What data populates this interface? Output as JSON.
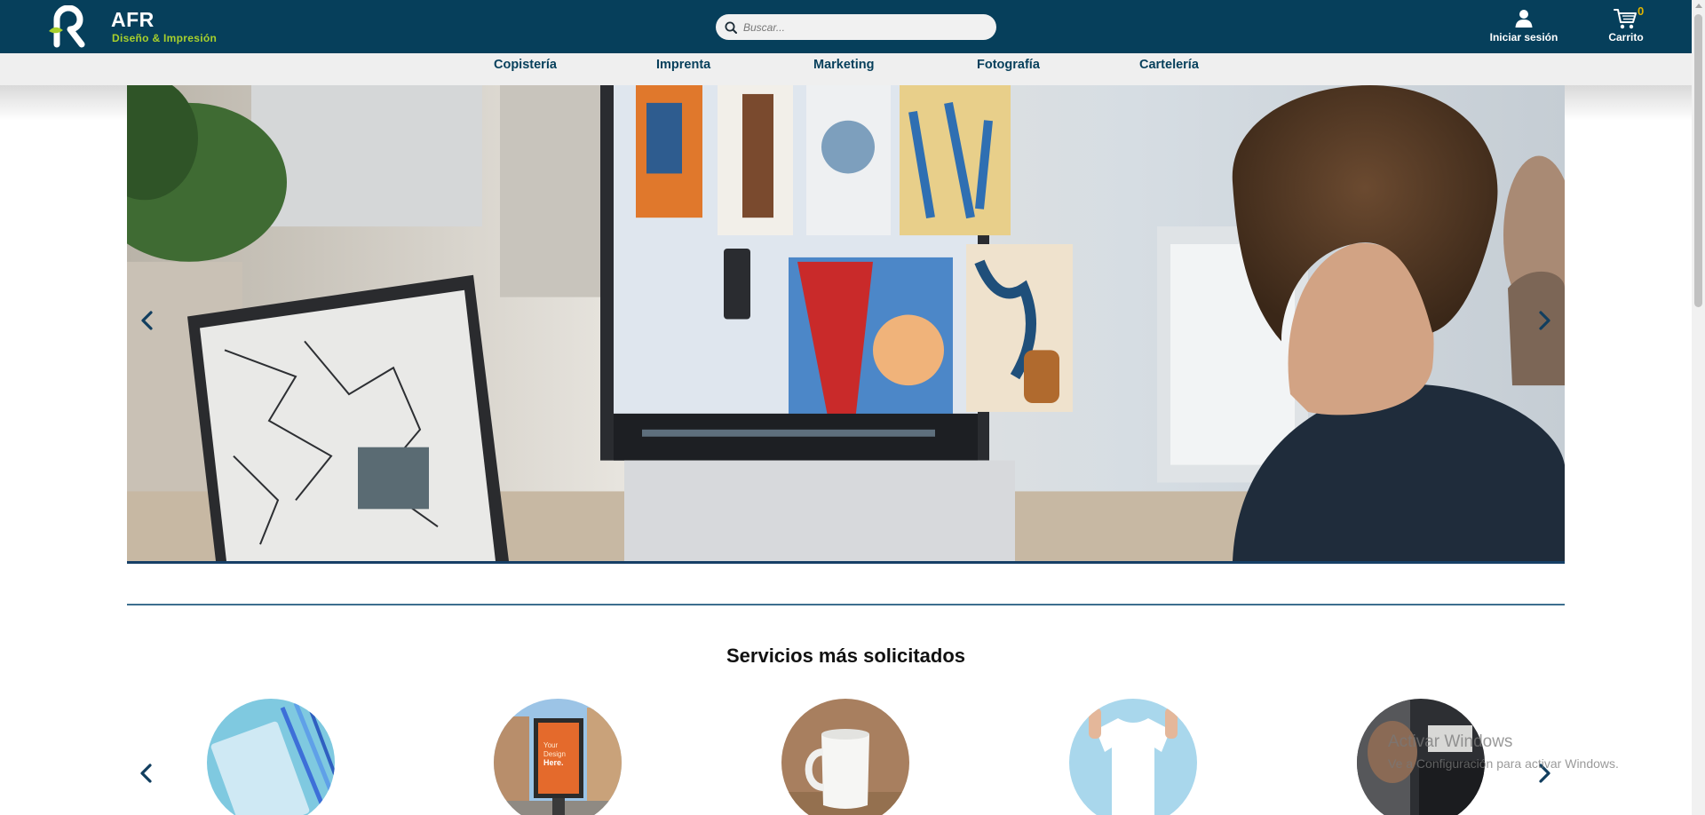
{
  "header": {
    "brand_name": "AFR",
    "brand_tagline": "Diseño & Impresión",
    "logo_icon": "afr-logo-icon",
    "search_placeholder": "Buscar...",
    "search_icon": "search-icon",
    "login_label": "Iniciar sesión",
    "login_icon": "user-icon",
    "cart_label": "Carrito",
    "cart_icon": "cart-icon",
    "cart_count": "0",
    "colors": {
      "bar": "#063f5b",
      "accent": "#a8d02c",
      "badge": "#e0b400"
    }
  },
  "nav": {
    "items": [
      {
        "label": "Copistería"
      },
      {
        "label": "Imprenta"
      },
      {
        "label": "Marketing"
      },
      {
        "label": "Fotografía"
      },
      {
        "label": "Cartelería"
      }
    ]
  },
  "hero": {
    "prev_icon": "chevron-left-icon",
    "next_icon": "chevron-right-icon"
  },
  "services": {
    "title": "Servicios más solicitados",
    "items": [
      {
        "icon": "notebook-image"
      },
      {
        "icon": "poster-image"
      },
      {
        "icon": "mug-image"
      },
      {
        "icon": "tshirt-image"
      },
      {
        "icon": "print-image"
      }
    ]
  },
  "watermark": {
    "line1": "Activar Windows",
    "line2": "Ve a Configuración para activar Windows."
  }
}
